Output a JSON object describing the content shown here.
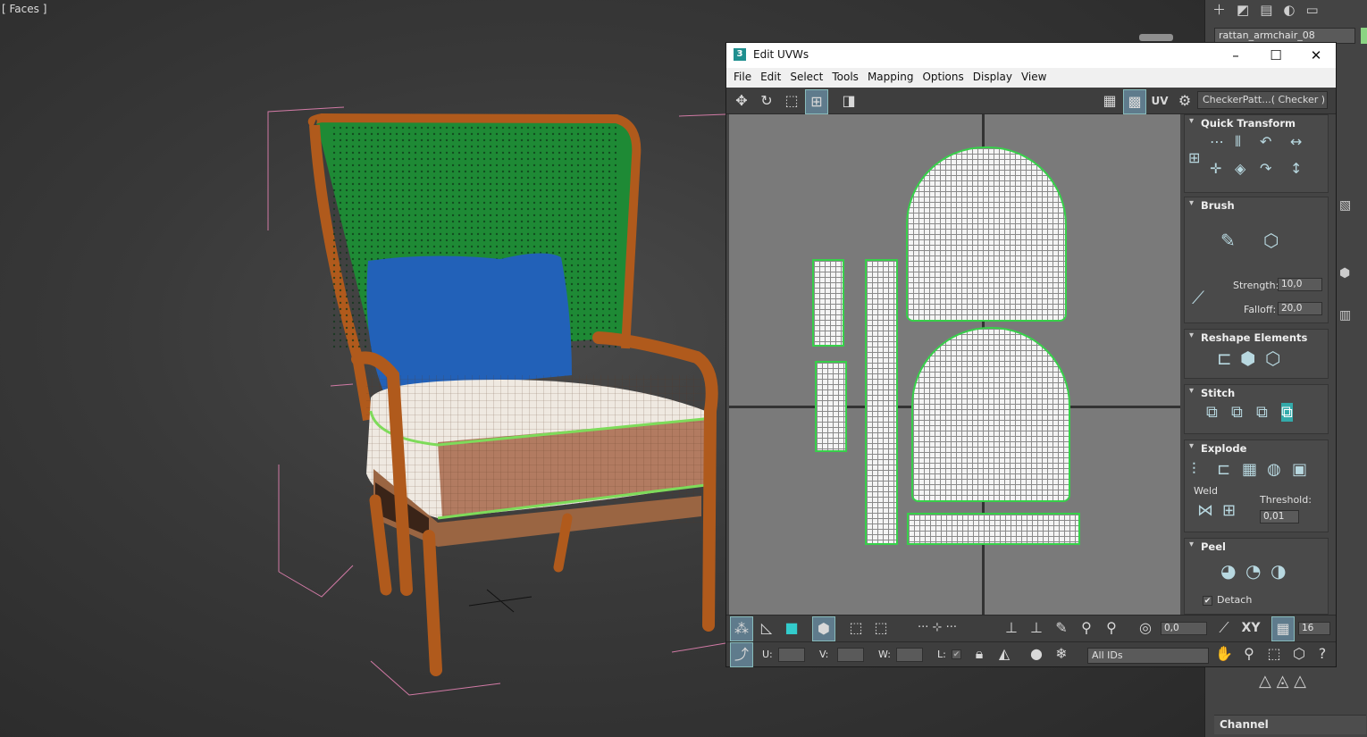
{
  "viewport": {
    "label": "[ Faces ]"
  },
  "command_panel": {
    "object_name": "rattan_armchair_08",
    "object_color": "#8bd483",
    "tabs": [
      "+",
      "modify",
      "hierarchy",
      "motion",
      "display"
    ],
    "channel_label": "Channel"
  },
  "uvw_window": {
    "title": "Edit UVWs",
    "menu": [
      "File",
      "Edit",
      "Select",
      "Tools",
      "Mapping",
      "Options",
      "Display",
      "View"
    ],
    "toolbar": {
      "uv_label": "UV",
      "checker_dropdown": "CheckerPatt...( Checker )"
    },
    "rollouts": {
      "quick_transform": "Quick Transform",
      "brush": "Brush",
      "strength_label": "Strength:",
      "strength_value": "10,0",
      "falloff_label": "Falloff:",
      "falloff_value": "20,0",
      "reshape": "Reshape Elements",
      "stitch": "Stitch",
      "explode": "Explode",
      "weld": "Weld",
      "threshold_label": "Threshold:",
      "threshold_value": "0,01",
      "peel": "Peel",
      "detach": "Detach"
    },
    "bottom": {
      "rotate_value": "0,0",
      "xy_label": "XY",
      "grid_value": "16",
      "u_label": "U:",
      "v_label": "V:",
      "w_label": "W:",
      "l_label": "L:",
      "ids_dropdown": "All IDs"
    }
  },
  "colors": {
    "shell_outline": "#37d04a",
    "accent": "#5f7b8c"
  }
}
